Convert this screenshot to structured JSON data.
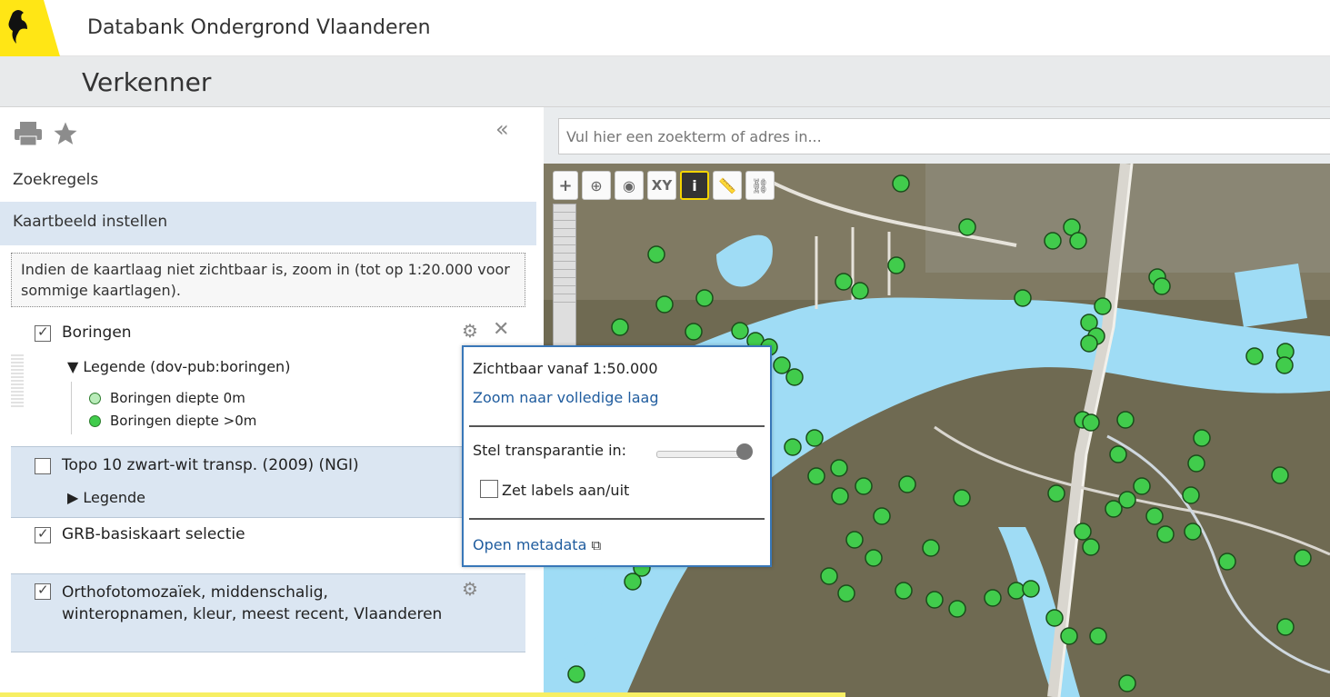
{
  "header": {
    "site_title": "Databank Ondergrond Vlaanderen",
    "page_title": "Verkenner"
  },
  "sidebar": {
    "sections": {
      "zoekregels": "Zoekregels",
      "kaartbeeld": "Kaartbeeld instellen"
    },
    "info_text": "Indien de kaartlaag niet zichtbaar is, zoom in (tot op 1:20.000 voor sommige kaartlagen).",
    "layers": {
      "boringen": {
        "name": "Boringen",
        "checked": true,
        "legend_title": "Legende (dov-pub:boringen)",
        "legend_items": [
          "Boringen diepte 0m",
          "Boringen diepte >0m"
        ]
      },
      "topo": {
        "name": "Topo 10 zwart-wit transp. (2009) (NGI)",
        "checked": false,
        "legend_label": "Legende"
      },
      "grb": {
        "name": "GRB-basiskaart selectie",
        "checked": true
      },
      "ortho": {
        "name": "Orthofotomozaïek, middenschalig, winteropnamen, kleur, meest recent, Vlaanderen",
        "checked": true
      }
    }
  },
  "search": {
    "placeholder": "Vul hier een zoekterm of adres in..."
  },
  "map_tools": {
    "zoom_in": "+",
    "xy": "XY",
    "info": "i"
  },
  "popup": {
    "visibility": "Zichtbaar vanaf 1:50.000",
    "zoom_link": "Zoom naar volledige laag",
    "transparency_label": "Stel transparantie in:",
    "transparency_level": 1.0,
    "labels_toggle": "Zet labels aan/uit",
    "metadata_link": "Open metadata"
  },
  "colors": {
    "water": "#9fdcf5",
    "land": "#6f6a52",
    "boring_point": "#41cc4c",
    "accent_blue": "#3877b8",
    "panel_blue": "#dbe6f2"
  }
}
